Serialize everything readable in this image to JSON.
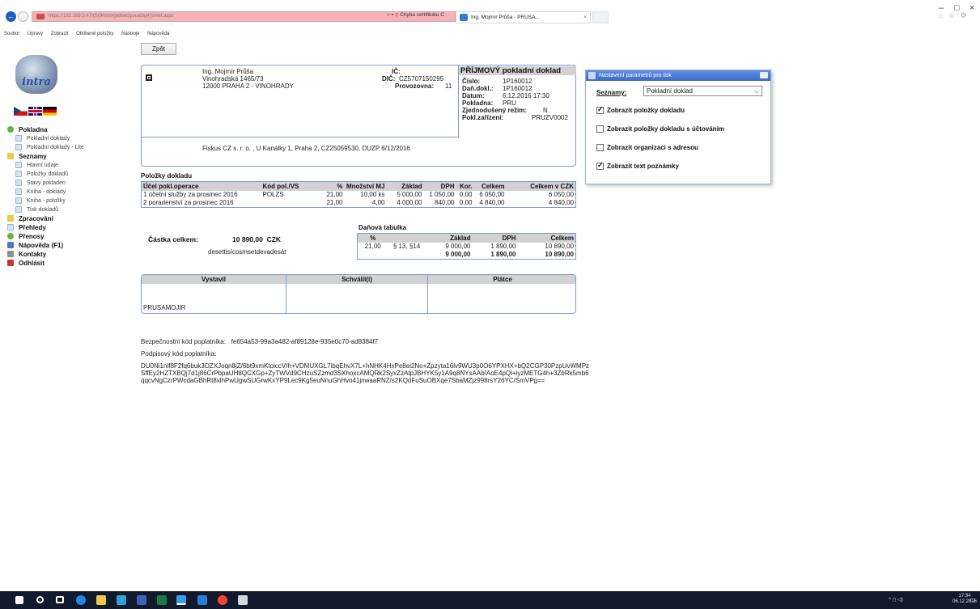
{
  "browser": {
    "url": "https://192.168.3.47/(S(9rlmrmjudoeclyoca3tg4))/vret.aspx",
    "cert_error": "Chyba certifikátu",
    "tab_title": "Ing. Mojmír Průša - PRUSA...",
    "tab_close": "×",
    "search_arrow": "⌕ ▾",
    "refresh": "C",
    "menu": [
      "Soubor",
      "Úpravy",
      "Zobrazit",
      "Oblíbené položky",
      "Nástroje",
      "Nápověda"
    ],
    "win_controls": [
      "–",
      "□",
      "×"
    ],
    "right_icons": "⌂ ☆ ⚙"
  },
  "page": {
    "back_label": "Zpět"
  },
  "sidebar": {
    "logo_text": "intra",
    "menu": [
      {
        "label": "Pokladna",
        "level": "top",
        "icon": "green-leaf-icon"
      },
      {
        "label": "Pokladní doklady",
        "level": "sub",
        "icon": "page-icon"
      },
      {
        "label": "Pokladní doklady - Lite",
        "level": "sub",
        "icon": "page-icon"
      },
      {
        "label": "Seznamy",
        "level": "top",
        "icon": "folder-icon"
      },
      {
        "label": "Hlavní údaje",
        "level": "sub",
        "icon": "page-icon"
      },
      {
        "label": "Položky dokladů",
        "level": "sub",
        "icon": "page-icon"
      },
      {
        "label": "Stavy pokladen",
        "level": "sub",
        "icon": "page-icon"
      },
      {
        "label": "Kniha - doklady",
        "level": "sub",
        "icon": "page-icon"
      },
      {
        "label": "Kniha - položky",
        "level": "sub",
        "icon": "page-icon"
      },
      {
        "label": "Tisk dokladů",
        "level": "sub",
        "icon": "page-icon"
      },
      {
        "label": "Zpracování",
        "level": "top",
        "icon": "folder-icon"
      },
      {
        "label": "Přehledy",
        "level": "top",
        "icon": "report-icon"
      },
      {
        "label": "Přenosy",
        "level": "top",
        "icon": "transfer-icon"
      },
      {
        "label": "Nápověda (F1)",
        "level": "top",
        "icon": "help-icon"
      },
      {
        "label": "Kontakty",
        "level": "top",
        "icon": "contacts-icon"
      },
      {
        "label": "Odhlásit",
        "level": "top",
        "icon": "logout-icon"
      }
    ]
  },
  "receipt": {
    "company": {
      "name": "Ing. Mojmír Průša",
      "street": "Vinohradská 1465/73",
      "city": "12000 PRAHA 2 - VINOHRADY"
    },
    "ic_label": "IČ:",
    "dic_label": "DIČ:",
    "dic_value": "CZ5707150295",
    "provozovna_label": "Provozovna:",
    "provozovna_value": "11",
    "doc_title": "PŘÍJMOVÝ pokladní doklad",
    "cislo_label": "Číslo:",
    "cislo_value": "1P160012",
    "dan_label": "Daň.dokl.:",
    "dan_value": "1P160012",
    "datum_label": "Datum:",
    "datum_value": "6.12.2016 17:30",
    "pokladna_label": "Pokladna:",
    "pokladna_value": "PRU",
    "zjed_label": "Zjednodušený režim:",
    "zjed_value": "N",
    "pokl_zar_label": "Pokl.zařízení:",
    "pokl_zar_value": "PRUZV0002",
    "fiskus": "Fiskus CZ s. r. o. , U Kanálky 1, Praha 2, CZ25059530, DUZP 6/12/2016"
  },
  "items": {
    "title": "Položky dokladu",
    "headers": [
      "Účel pokl.operace",
      "Kód pol./VS",
      "%",
      "Množství MJ",
      "Základ",
      "DPH",
      "Kor.",
      "Celkem",
      "Celkem v CZK"
    ],
    "rows": [
      [
        "1 účetní služby za prosinec 2016",
        "POLZS",
        "21,00",
        "10,00 ks",
        "5 000,00",
        "1 050,00",
        "0,00",
        "6 050,00",
        "6 050,00"
      ],
      [
        "2 poradenství za prosinec 2016",
        "",
        "21,00",
        "4,00",
        "4 000,00",
        "840,00",
        "0,00",
        "4 840,00",
        "4 840,00"
      ]
    ]
  },
  "summary": {
    "label": "Částka celkem:",
    "value": "10 890,00",
    "currency": "CZK",
    "words": "desettisícosmsetdevadesát"
  },
  "tax": {
    "title": "Daňová tabulka",
    "headers": [
      "%",
      "",
      "Základ",
      "DPH",
      "Celkem"
    ],
    "rows": [
      [
        "21,00",
        "§ 13, §14",
        "9 000,00",
        "1 890,00",
        "10 890,00"
      ],
      [
        "",
        "",
        "9 000,00",
        "1 890,00",
        "10 890,00"
      ]
    ]
  },
  "signatures": {
    "cols": [
      "Vystavil",
      "Schválil(i)",
      "Plátce"
    ],
    "vystavil_name": "PRUSAMOJIR"
  },
  "codes": {
    "bkp_label": "Bezpečnostní kód poplatníka:",
    "bkp_value": "fe654a53-99a3a482-af89128e-935e0c70-ad8384f7",
    "pkp_label": "Podpisový kód poplatníka:",
    "pkp_value": "DU0Ni1nlf8F2fq6buk3OZXJoqn8jZ/6bt9xmKtoiccV/h+VDMUXGL7ibqEhvX7L+hNHK4HxPe8ei2No+Zpzyta16lv9WU3p0O6YPXHX+bQ2CGP30PzpUvWMPzSffEy2HZTXBQj7d1j86CrPbpaUH8QCXGp+ZyTWVd9CHzuSZzmd3SXhoxcAMQRk2SyxZzAtpJBHYK5y1A9q8NYsAAb/AoE4pQl+iyzMETG4h+3ZbRk5mb6qqcvNgCzrPWcdaGBhRt8xlhPwUgwSUGrwKxYP9Lec9Kg5euNnuGhHvo41jnwaaRNZ/s2KQdFuSuOBXqe7SbaMZjz998rsY26YC/SmVPg=="
  },
  "print_panel": {
    "title": "Nastavení parametrů pro tisk",
    "seznamy_label": "Seznamy:",
    "seznamy_value": "Pokladní doklad",
    "options": [
      {
        "label": "Zobrazit položky dokladu",
        "checked": true
      },
      {
        "label": "Zobrazit položky dokladu s účtováním",
        "checked": false
      },
      {
        "label": "Zobrazit organizaci s adresou",
        "checked": false
      },
      {
        "label": "Zobrazit text poznámky",
        "checked": true
      }
    ]
  },
  "taskbar": {
    "time": "17:34",
    "date": "06.12.2016"
  }
}
